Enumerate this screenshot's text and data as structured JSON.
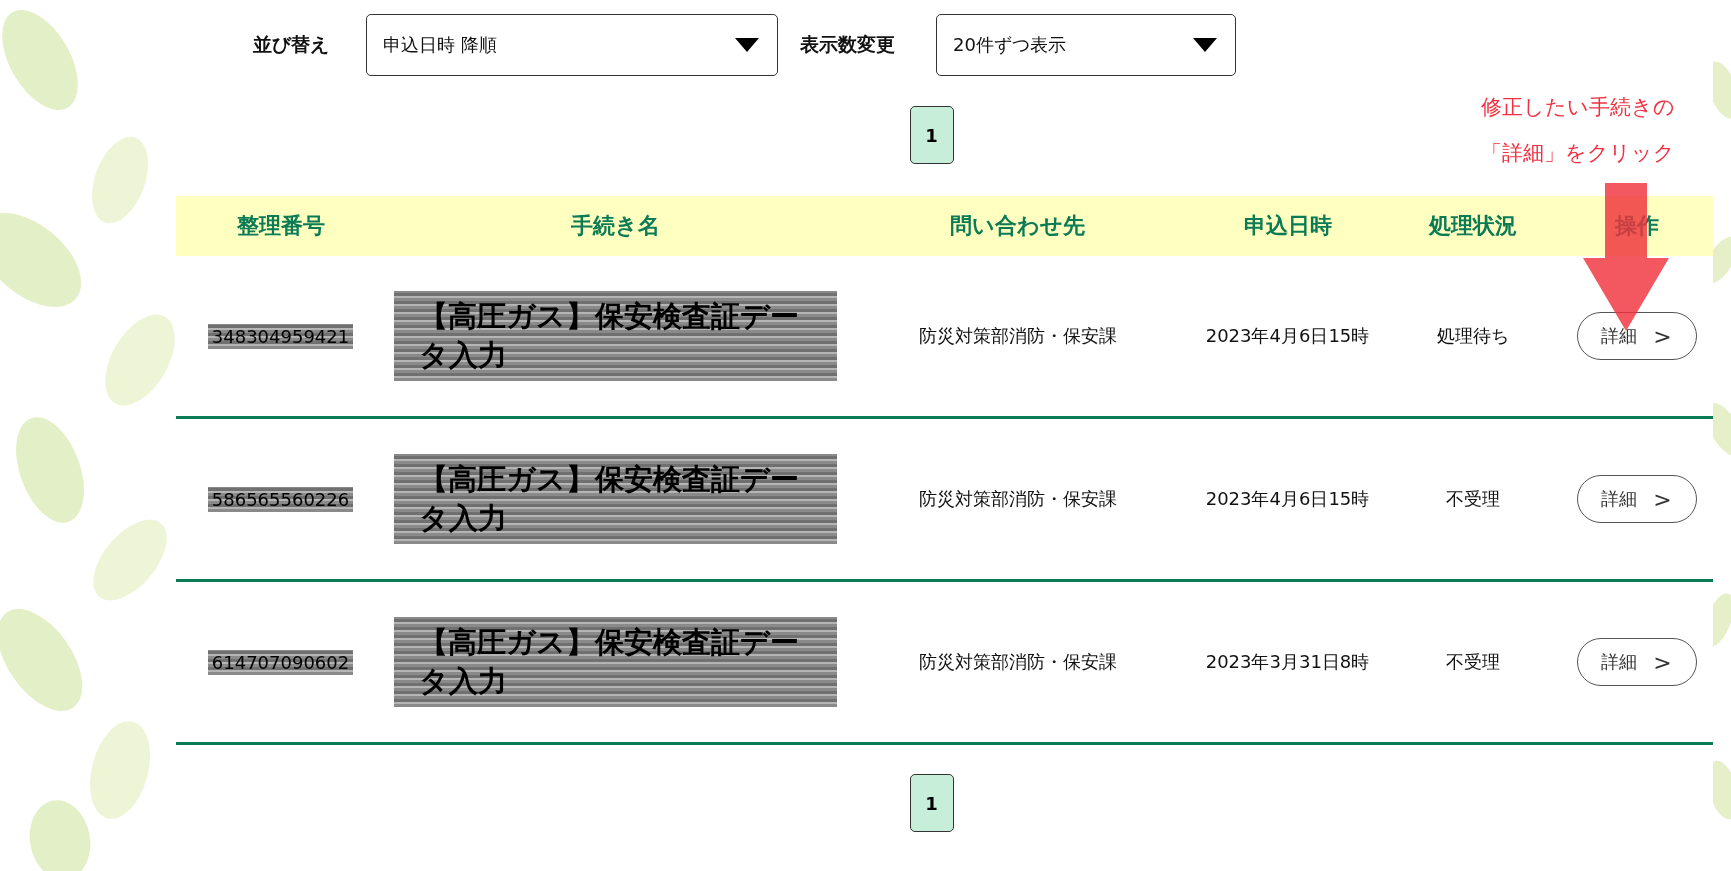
{
  "sort": {
    "label": "並び替え",
    "value": "申込日時 降順"
  },
  "per_page": {
    "label": "表示数変更",
    "value": "20件ずつ表示"
  },
  "pagination_top": [
    {
      "label": "1",
      "selected": true
    }
  ],
  "annotation": [
    "修正したい手続きの",
    "「詳細」をクリック"
  ],
  "table": {
    "columns": [
      "整理番号",
      "手続き名",
      "問い合わせ先",
      "申込日時",
      "処理状況",
      "操作"
    ],
    "rows": [
      {
        "number": "348304959421",
        "name": "【高圧ガス】保安検査証データ入力",
        "contact": "防災対策部消防・保安課",
        "date": "2023年4月6日15時",
        "status": "処理待ち",
        "action": "詳細",
        "action_icon": ">"
      },
      {
        "number": "586565560226",
        "name": "【高圧ガス】保安検査証データ入力",
        "contact": "防災対策部消防・保安課",
        "date": "2023年4月6日15時",
        "status": "不受理",
        "action": "詳細",
        "action_icon": ">"
      },
      {
        "number": "614707090602",
        "name": "【高圧ガス】保安検査証データ入力",
        "contact": "防災対策部消防・保安課",
        "date": "2023年3月31日8時",
        "status": "不受理",
        "action": "詳細",
        "action_icon": ">"
      }
    ]
  },
  "pagination_bottom": [
    {
      "label": "1",
      "selected": true
    }
  ]
}
